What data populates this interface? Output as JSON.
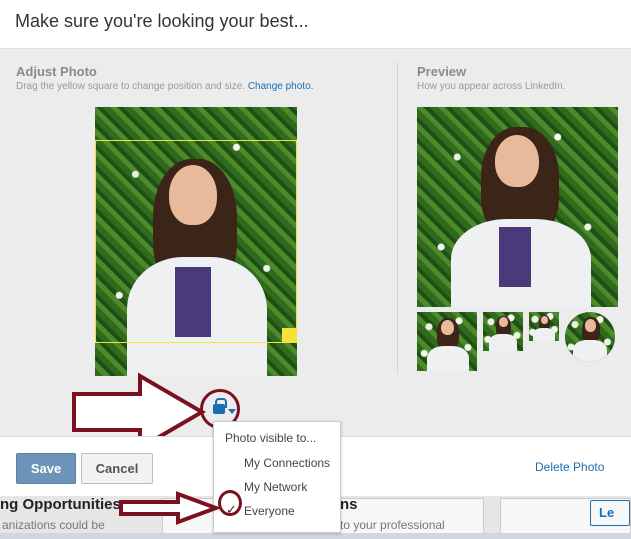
{
  "dialog": {
    "title": "Make sure you're looking your best...",
    "adjust": {
      "heading": "Adjust Photo",
      "instructions": "Drag the yellow square to change position and size.",
      "change_link": "Change photo."
    },
    "preview": {
      "heading": "Preview",
      "subtitle": "How you appear across LinkedIn."
    },
    "rotate_icon": "rotate-counterclockwise-icon",
    "visibility": {
      "menu_title": "Photo visible to...",
      "options": [
        "My Connections",
        "My Network",
        "Everyone"
      ],
      "selected": "Everyone"
    },
    "footer": {
      "save_label": "Save",
      "cancel_label": "Cancel",
      "delete_label": "Delete Photo"
    }
  },
  "background_page": {
    "left_heading": "ng Opportunities",
    "left_sub": "anizations could be",
    "middle_heading": "ns",
    "middle_sub": "to your professional",
    "right_button": "Le"
  },
  "colors": {
    "crop_square": "#f4e23a",
    "link": "#1a6fb4",
    "save_button": "#6d93b8",
    "annotation": "#7a1020"
  }
}
